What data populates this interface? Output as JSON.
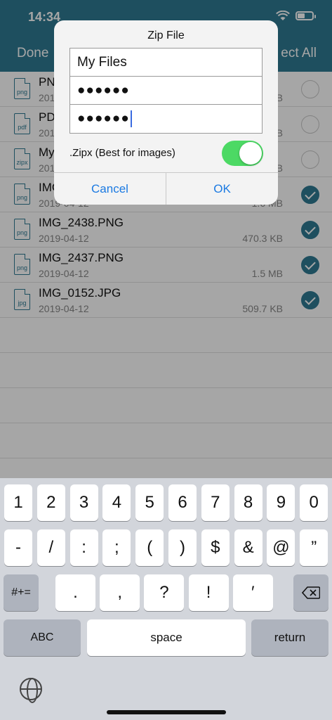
{
  "status": {
    "time": "14:34",
    "battery_level": 0.45
  },
  "nav": {
    "done_label": "Done",
    "select_all_label": "ect All"
  },
  "files": [
    {
      "name": "PN",
      "date": "2019",
      "size": "KB",
      "icon": "png",
      "selected": false
    },
    {
      "name": "PD",
      "date": "2019",
      "size": "KB",
      "icon": "pdf",
      "selected": false
    },
    {
      "name": "My",
      "date": "2019",
      "size": "B",
      "icon": "zipx",
      "selected": false
    },
    {
      "name": "IMG",
      "date": "2019-04-12",
      "size": "1.6 MB",
      "icon": "png",
      "selected": true
    },
    {
      "name": "IMG_2438.PNG",
      "date": "2019-04-12",
      "size": "470.3 KB",
      "icon": "png",
      "selected": true
    },
    {
      "name": "IMG_2437.PNG",
      "date": "2019-04-12",
      "size": "1.5 MB",
      "icon": "png",
      "selected": true
    },
    {
      "name": "IMG_0152.JPG",
      "date": "2019-04-12",
      "size": "509.7 KB",
      "icon": "jpg",
      "selected": true
    }
  ],
  "dialog": {
    "title": "Zip File",
    "filename_value": "My Files",
    "password_value": "●●●●●●",
    "confirm_value": "●●●●●●",
    "zipx_label": ".Zipx (Best for images)",
    "zipx_enabled": true,
    "cancel_label": "Cancel",
    "ok_label": "OK"
  },
  "keyboard": {
    "row1": [
      "1",
      "2",
      "3",
      "4",
      "5",
      "6",
      "7",
      "8",
      "9",
      "0"
    ],
    "row2": [
      "-",
      "/",
      ":",
      ";",
      "(",
      ")",
      "$",
      "&",
      "@",
      "”"
    ],
    "row3": [
      ".",
      ",",
      "?",
      "!",
      "′"
    ],
    "symbols_label": "#+=",
    "abc_label": "ABC",
    "space_label": "space",
    "return_label": "return",
    "backspace_icon": "backspace-icon",
    "globe_icon": "globe-icon"
  }
}
